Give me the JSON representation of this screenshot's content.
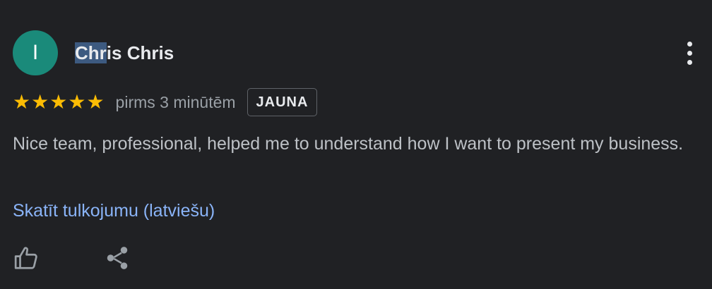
{
  "review": {
    "avatar_letter": "I",
    "author_highlighted": "Chr",
    "author_rest": "is Chris",
    "rating": 5,
    "stars": [
      "★",
      "★",
      "★",
      "★",
      "★"
    ],
    "date": "pirms 3 minūtēm",
    "badge": "JAUNA",
    "text": "Nice team, professional, helped me to understand how I want to present my business.",
    "translate_link": "Skatīt tulkojumu (latviešu)"
  },
  "actions": {
    "like_icon": "thumbs-up-icon",
    "share_icon": "share-icon",
    "more_icon": "more-vert-icon"
  },
  "colors": {
    "background": "#202124",
    "avatar": "#1a8a7a",
    "star": "#fbbc04",
    "link": "#8ab4f8",
    "selection": "#3d5a80"
  }
}
